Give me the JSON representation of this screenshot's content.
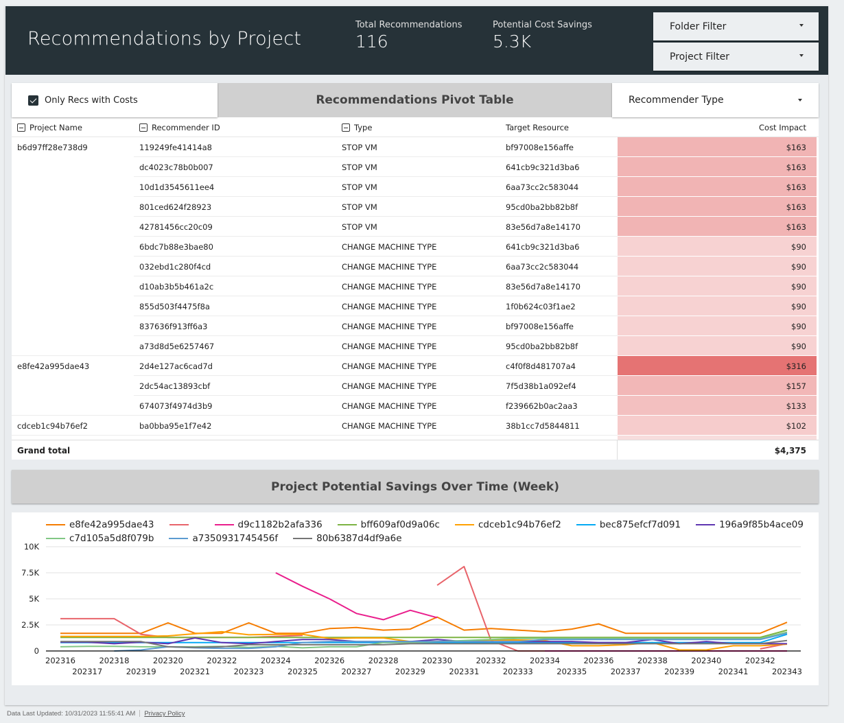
{
  "header": {
    "title": "Recommendations by Project",
    "kpis": [
      {
        "label": "Total Recommendations",
        "value": "116"
      },
      {
        "label": "Potential Cost Savings",
        "value": "5.3K"
      }
    ],
    "filters": [
      {
        "label": "Folder Filter"
      },
      {
        "label": "Project Filter"
      }
    ]
  },
  "pivot": {
    "checkbox_label": "Only Recs with Costs",
    "checkbox_checked": true,
    "title": "Recommendations Pivot Table",
    "recommender_type_label": "Recommender Type",
    "columns": [
      "Project Name",
      "Recommender ID",
      "Type",
      "Target Resource",
      "Cost Impact"
    ],
    "rows": [
      {
        "project": "b6d97ff28e738d9",
        "rec_id": "119249fe41414a8",
        "type": "STOP VM",
        "target": "bf97008e156affe",
        "cost": "$163",
        "heat": 0.45
      },
      {
        "project": "",
        "rec_id": "dc4023c78b0b007",
        "type": "STOP VM",
        "target": "641cb9c321d3ba6",
        "cost": "$163",
        "heat": 0.45
      },
      {
        "project": "",
        "rec_id": "10d1d3545611ee4",
        "type": "STOP VM",
        "target": "6aa73cc2c583044",
        "cost": "$163",
        "heat": 0.45
      },
      {
        "project": "",
        "rec_id": "801ced624f28923",
        "type": "STOP VM",
        "target": "95cd0ba2bb82b8f",
        "cost": "$163",
        "heat": 0.45
      },
      {
        "project": "",
        "rec_id": "42781456cc20c09",
        "type": "STOP VM",
        "target": "83e56d7a8e14170",
        "cost": "$163",
        "heat": 0.45
      },
      {
        "project": "",
        "rec_id": "6bdc7b88e3bae80",
        "type": "CHANGE MACHINE TYPE",
        "target": "641cb9c321d3ba6",
        "cost": "$90",
        "heat": 0.2
      },
      {
        "project": "",
        "rec_id": "032ebd1c280f4cd",
        "type": "CHANGE MACHINE TYPE",
        "target": "6aa73cc2c583044",
        "cost": "$90",
        "heat": 0.2
      },
      {
        "project": "",
        "rec_id": "d10ab3b5b461a2c",
        "type": "CHANGE MACHINE TYPE",
        "target": "83e56d7a8e14170",
        "cost": "$90",
        "heat": 0.2
      },
      {
        "project": "",
        "rec_id": "855d503f4475f8a",
        "type": "CHANGE MACHINE TYPE",
        "target": "1f0b624c03f1ae2",
        "cost": "$90",
        "heat": 0.2
      },
      {
        "project": "",
        "rec_id": "837636f913ff6a3",
        "type": "CHANGE MACHINE TYPE",
        "target": "bf97008e156affe",
        "cost": "$90",
        "heat": 0.2
      },
      {
        "project": "",
        "rec_id": "a73d8d5e6257467",
        "type": "CHANGE MACHINE TYPE",
        "target": "95cd0ba2bb82b8f",
        "cost": "$90",
        "heat": 0.2
      },
      {
        "project": "e8fe42a995dae43",
        "rec_id": "2d4e127ac6cad7d",
        "type": "CHANGE MACHINE TYPE",
        "target": "c4f0f8d481707a4",
        "cost": "$316",
        "heat": 1.0
      },
      {
        "project": "",
        "rec_id": "2dc54ac13893cbf",
        "type": "CHANGE MACHINE TYPE",
        "target": "7f5d38b1a092ef4",
        "cost": "$157",
        "heat": 0.43
      },
      {
        "project": "",
        "rec_id": "674073f4974d3b9",
        "type": "CHANGE MACHINE TYPE",
        "target": "f239662b0ac2aa3",
        "cost": "$133",
        "heat": 0.35
      },
      {
        "project": "cdceb1c94b76ef2",
        "rec_id": "ba0bba95e1f7e42",
        "type": "CHANGE MACHINE TYPE",
        "target": "38b1cc7d5844811",
        "cost": "$102",
        "heat": 0.25
      }
    ],
    "grand_total_label": "Grand total",
    "grand_total_value": "$4,375",
    "heat_color": "#e57373"
  },
  "chart_section": {
    "title": "Project Potential Savings Over Time (Week)"
  },
  "chart_data": {
    "type": "line",
    "title": "Project Potential Savings Over Time (Week)",
    "xlabel": "",
    "ylabel": "",
    "x": [
      "202316",
      "202317",
      "202318",
      "202319",
      "202320",
      "202321",
      "202322",
      "202323",
      "202324",
      "202325",
      "202326",
      "202327",
      "202328",
      "202329",
      "202330",
      "202331",
      "202332",
      "202333",
      "202334",
      "202335",
      "202336",
      "202337",
      "202338",
      "202339",
      "202340",
      "202341",
      "202342",
      "202343"
    ],
    "y_ticks": [
      "0",
      "2.5K",
      "5K",
      "7.5K",
      "10K"
    ],
    "ylim": [
      0,
      10000
    ],
    "grid": true,
    "legend_position": "top",
    "series": [
      {
        "name": "e8fe42a995dae43",
        "color": "#f57c00",
        "values": [
          1700,
          1700,
          1700,
          1700,
          2700,
          1700,
          1700,
          2700,
          1700,
          1700,
          2150,
          2250,
          2000,
          2100,
          3250,
          2000,
          2150,
          2000,
          1850,
          2100,
          2600,
          1700,
          1700,
          1700,
          1700,
          1700,
          1700,
          2750
        ]
      },
      {
        "name": "",
        "color": "#e8636a",
        "values": [
          3100,
          3100,
          3100,
          1600,
          1300,
          1300,
          1300,
          1300,
          1400,
          1500,
          null,
          null,
          null,
          null,
          6300,
          8100,
          1000,
          0,
          0,
          null,
          null,
          null,
          null,
          null,
          null,
          null,
          200,
          700
        ]
      },
      {
        "name": "d9c1182b2afa336",
        "color": "#e91e8c",
        "values": [
          null,
          null,
          null,
          null,
          null,
          null,
          null,
          null,
          7500,
          6200,
          5000,
          3600,
          3000,
          3900,
          3200,
          null,
          null,
          null,
          0,
          0,
          0,
          0,
          0,
          0,
          0,
          0,
          0,
          0
        ]
      },
      {
        "name": "bff609af0d9a06c",
        "color": "#7cb342",
        "values": [
          1300,
          1300,
          1300,
          1300,
          1300,
          1300,
          1300,
          1300,
          1300,
          1300,
          1300,
          1300,
          1300,
          1300,
          1300,
          1300,
          1300,
          1300,
          1300,
          1300,
          1300,
          1300,
          1300,
          1300,
          1300,
          1300,
          1300,
          2000
        ]
      },
      {
        "name": "cdceb1c94b76ef2",
        "color": "#ffa000",
        "values": [
          1400,
          1400,
          1400,
          1400,
          1450,
          1650,
          1850,
          1550,
          1600,
          1600,
          1200,
          1250,
          1250,
          900,
          900,
          900,
          1050,
          1050,
          1000,
          500,
          500,
          600,
          800,
          100,
          100,
          500,
          500,
          650
        ]
      },
      {
        "name": "bec875efcf7d091",
        "color": "#03a9f4",
        "values": [
          800,
          800,
          800,
          800,
          800,
          800,
          800,
          800,
          800,
          800,
          800,
          800,
          800,
          800,
          800,
          800,
          800,
          800,
          800,
          800,
          800,
          800,
          800,
          800,
          800,
          800,
          800,
          1600
        ]
      },
      {
        "name": "196a9f85b4ace09",
        "color": "#5e35b1",
        "values": [
          850,
          850,
          700,
          850,
          700,
          1250,
          800,
          700,
          900,
          1100,
          1100,
          900,
          900,
          900,
          1100,
          900,
          900,
          900,
          900,
          900,
          800,
          800,
          1100,
          700,
          900,
          700,
          700,
          700
        ]
      },
      {
        "name": "c7d105a5d8f079b",
        "color": "#81c784",
        "values": [
          400,
          450,
          450,
          400,
          400,
          400,
          450,
          350,
          450,
          300,
          400,
          400,
          800,
          800,
          900,
          1000,
          1100,
          1200,
          1200,
          1200,
          1200,
          1200,
          1200,
          1200,
          1200,
          1200,
          1200,
          1800
        ]
      },
      {
        "name": "a7350931745456f",
        "color": "#5c9bd1",
        "values": [
          null,
          null,
          0,
          100,
          400,
          300,
          250,
          250,
          400,
          800,
          900,
          900,
          900,
          900,
          900,
          900,
          900,
          900,
          1100,
          1100,
          1100,
          1100,
          1100,
          1100,
          1100,
          1100,
          1100,
          1700
        ]
      },
      {
        "name": "80b6387d4df9a6e",
        "color": "#757575",
        "values": [
          900,
          900,
          900,
          900,
          400,
          350,
          400,
          600,
          600,
          600,
          600,
          600,
          600,
          700,
          700,
          700,
          700,
          700,
          700,
          700,
          700,
          700,
          700,
          700,
          700,
          700,
          700,
          1000
        ]
      }
    ]
  },
  "footer": {
    "updated": "Data Last Updated: 10/31/2023 11:55:41 AM",
    "privacy": "Privacy Policy"
  }
}
